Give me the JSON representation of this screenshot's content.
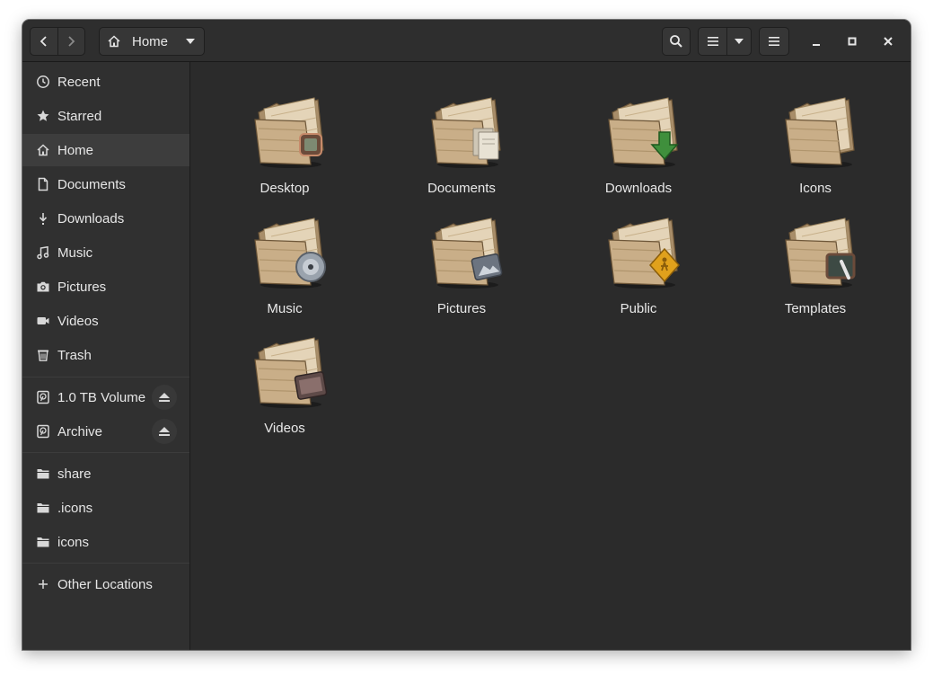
{
  "window": {
    "path_location": "Home"
  },
  "sidebar": {
    "places": [
      {
        "label": "Recent",
        "icon": "clock-icon"
      },
      {
        "label": "Starred",
        "icon": "star-icon"
      },
      {
        "label": "Home",
        "icon": "home-icon",
        "active": true
      },
      {
        "label": "Documents",
        "icon": "document-icon"
      },
      {
        "label": "Downloads",
        "icon": "download-icon"
      },
      {
        "label": "Music",
        "icon": "music-note-icon"
      },
      {
        "label": "Pictures",
        "icon": "camera-icon"
      },
      {
        "label": "Videos",
        "icon": "video-camera-icon"
      },
      {
        "label": "Trash",
        "icon": "trash-icon"
      }
    ],
    "devices": [
      {
        "label": "1.0 TB Volume",
        "icon": "drive-icon"
      },
      {
        "label": "Archive",
        "icon": "drive-icon"
      }
    ],
    "bookmarks": [
      {
        "label": "share",
        "icon": "folder-icon"
      },
      {
        "label": ".icons",
        "icon": "folder-icon"
      },
      {
        "label": "icons",
        "icon": "folder-icon"
      }
    ],
    "other": {
      "label": "Other Locations",
      "icon": "plus-icon"
    }
  },
  "files": [
    {
      "name": "Desktop",
      "emblem": "monitor-emblem"
    },
    {
      "name": "Documents",
      "emblem": "paper-emblem"
    },
    {
      "name": "Downloads",
      "emblem": "green-arrow-emblem"
    },
    {
      "name": "Icons",
      "emblem": "none"
    },
    {
      "name": "Music",
      "emblem": "disc-emblem"
    },
    {
      "name": "Pictures",
      "emblem": "photo-emblem"
    },
    {
      "name": "Public",
      "emblem": "person-sign-emblem"
    },
    {
      "name": "Templates",
      "emblem": "slate-emblem"
    },
    {
      "name": "Videos",
      "emblem": "film-emblem"
    }
  ],
  "colors": {
    "window_bg": "#2b2b2b",
    "sidebar_bg": "#303030",
    "sidebar_active": "#3d3d3d",
    "text": "#e6e6e6",
    "folder_tan": "#c9ae88"
  }
}
